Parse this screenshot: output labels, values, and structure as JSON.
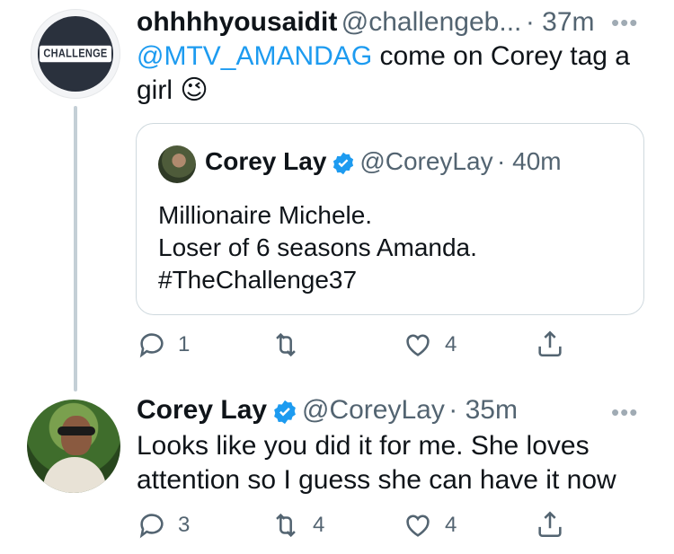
{
  "tweet1": {
    "display_name": "ohhhhyousaidit",
    "handle": "@challengeb...",
    "time": "· 37m",
    "more": "•••",
    "mention": "@MTV_AMANDAG",
    "text_after_mention": " come on Corey tag a",
    "text_line2": "girl ",
    "emoji": "😉",
    "avatar_logo_text": "CHALLENGE",
    "quote": {
      "display_name": "Corey Lay",
      "handle": "@CoreyLay",
      "time": "· 40m",
      "lines": [
        "Millionaire Michele.",
        "Loser of 6 seasons Amanda.",
        "#TheChallenge37"
      ]
    },
    "actions": {
      "replies": "1",
      "retweets": "",
      "likes": "4"
    }
  },
  "tweet2": {
    "display_name": "Corey Lay",
    "handle": "@CoreyLay",
    "time": "· 35m",
    "more": "•••",
    "lines": [
      "Looks like you did it for me. She loves",
      "attention so I guess she can have it now"
    ],
    "actions": {
      "replies": "3",
      "retweets": "4",
      "likes": "4"
    }
  },
  "colors": {
    "accent": "#1d9bf0",
    "muted": "#536471",
    "border": "#cfd9de",
    "thread": "#c4cfd6"
  }
}
